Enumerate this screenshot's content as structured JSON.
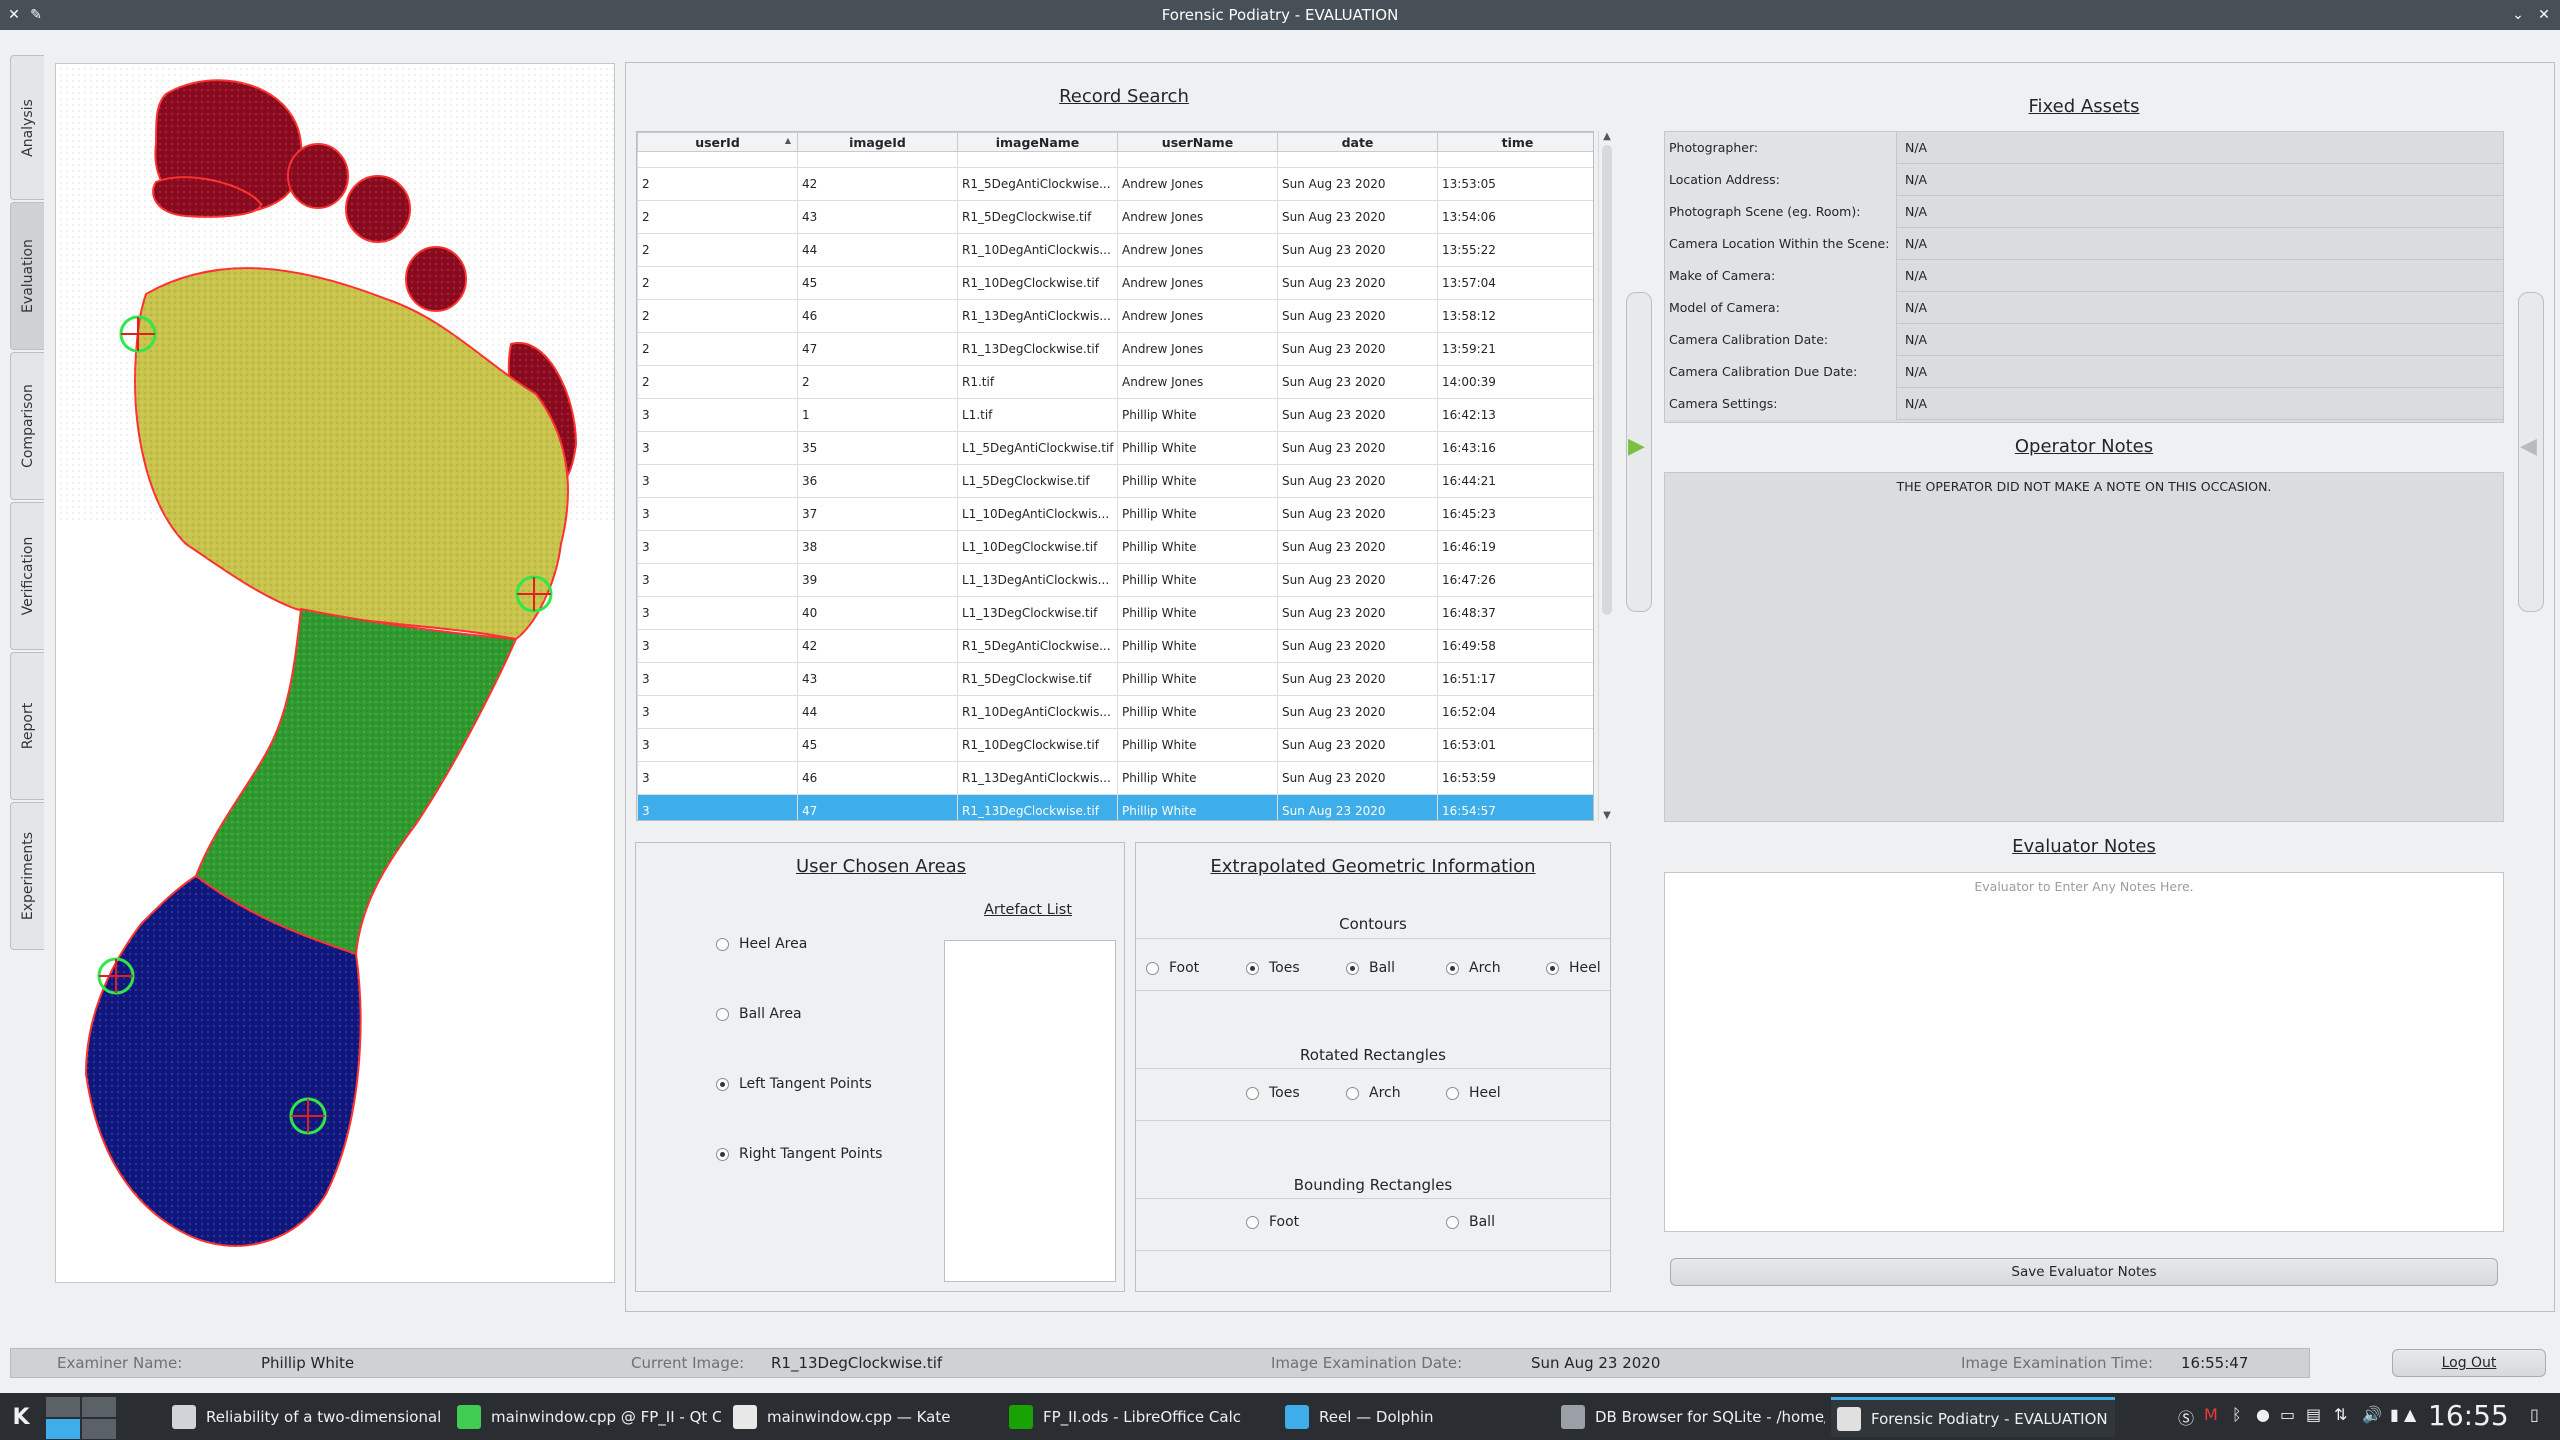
{
  "window": {
    "title": "Forensic Podiatry - EVALUATION"
  },
  "side_tabs": [
    "Analysis",
    "Evaluation",
    "Comparison",
    "Verification",
    "Report",
    "Experiments"
  ],
  "record_search": {
    "title": "Record Search",
    "columns": [
      "userId",
      "imageId",
      "imageName",
      "userName",
      "date",
      "time"
    ],
    "rows": [
      [
        "2",
        "42",
        "R1_5DegAntiClockwise...",
        "Andrew Jones",
        "Sun Aug 23 2020",
        "13:53:05"
      ],
      [
        "2",
        "43",
        "R1_5DegClockwise.tif",
        "Andrew Jones",
        "Sun Aug 23 2020",
        "13:54:06"
      ],
      [
        "2",
        "44",
        "R1_10DegAntiClockwis...",
        "Andrew Jones",
        "Sun Aug 23 2020",
        "13:55:22"
      ],
      [
        "2",
        "45",
        "R1_10DegClockwise.tif",
        "Andrew Jones",
        "Sun Aug 23 2020",
        "13:57:04"
      ],
      [
        "2",
        "46",
        "R1_13DegAntiClockwis...",
        "Andrew Jones",
        "Sun Aug 23 2020",
        "13:58:12"
      ],
      [
        "2",
        "47",
        "R1_13DegClockwise.tif",
        "Andrew Jones",
        "Sun Aug 23 2020",
        "13:59:21"
      ],
      [
        "2",
        "2",
        "R1.tif",
        "Andrew Jones",
        "Sun Aug 23 2020",
        "14:00:39"
      ],
      [
        "3",
        "1",
        "L1.tif",
        "Phillip White",
        "Sun Aug 23 2020",
        "16:42:13"
      ],
      [
        "3",
        "35",
        "L1_5DegAntiClockwise.tif",
        "Phillip White",
        "Sun Aug 23 2020",
        "16:43:16"
      ],
      [
        "3",
        "36",
        "L1_5DegClockwise.tif",
        "Phillip White",
        "Sun Aug 23 2020",
        "16:44:21"
      ],
      [
        "3",
        "37",
        "L1_10DegAntiClockwis...",
        "Phillip White",
        "Sun Aug 23 2020",
        "16:45:23"
      ],
      [
        "3",
        "38",
        "L1_10DegClockwise.tif",
        "Phillip White",
        "Sun Aug 23 2020",
        "16:46:19"
      ],
      [
        "3",
        "39",
        "L1_13DegAntiClockwis...",
        "Phillip White",
        "Sun Aug 23 2020",
        "16:47:26"
      ],
      [
        "3",
        "40",
        "L1_13DegClockwise.tif",
        "Phillip White",
        "Sun Aug 23 2020",
        "16:48:37"
      ],
      [
        "3",
        "42",
        "R1_5DegAntiClockwise...",
        "Phillip White",
        "Sun Aug 23 2020",
        "16:49:58"
      ],
      [
        "3",
        "43",
        "R1_5DegClockwise.tif",
        "Phillip White",
        "Sun Aug 23 2020",
        "16:51:17"
      ],
      [
        "3",
        "44",
        "R1_10DegAntiClockwis...",
        "Phillip White",
        "Sun Aug 23 2020",
        "16:52:04"
      ],
      [
        "3",
        "45",
        "R1_10DegClockwise.tif",
        "Phillip White",
        "Sun Aug 23 2020",
        "16:53:01"
      ],
      [
        "3",
        "46",
        "R1_13DegAntiClockwis...",
        "Phillip White",
        "Sun Aug 23 2020",
        "16:53:59"
      ],
      [
        "3",
        "47",
        "R1_13DegClockwise.tif",
        "Phillip White",
        "Sun Aug 23 2020",
        "16:54:57"
      ]
    ],
    "selected_row": 19
  },
  "user_areas": {
    "title": "User Chosen Areas",
    "artefact_title": "Artefact List",
    "options": [
      {
        "label": "Heel Area",
        "checked": false
      },
      {
        "label": "Ball Area",
        "checked": false
      },
      {
        "label": "Left Tangent Points",
        "checked": true
      },
      {
        "label": "Right Tangent Points",
        "checked": true
      }
    ]
  },
  "geometric": {
    "title": "Extrapolated Geometric Information",
    "contours_title": "Contours",
    "contours": [
      {
        "label": "Foot",
        "checked": false
      },
      {
        "label": "Toes",
        "checked": true
      },
      {
        "label": "Ball",
        "checked": true
      },
      {
        "label": "Arch",
        "checked": true
      },
      {
        "label": "Heel",
        "checked": true
      }
    ],
    "rotated_title": "Rotated Rectangles",
    "rotated": [
      {
        "label": "Toes",
        "checked": false
      },
      {
        "label": "Arch",
        "checked": false
      },
      {
        "label": "Heel",
        "checked": false
      }
    ],
    "bounding_title": "Bounding Rectangles",
    "bounding": [
      {
        "label": "Foot",
        "checked": false
      },
      {
        "label": "Ball",
        "checked": false
      }
    ]
  },
  "fixed_assets": {
    "title": "Fixed Assets",
    "rows": [
      {
        "key": "Photographer:",
        "value": "N/A"
      },
      {
        "key": "Location Address:",
        "value": "N/A"
      },
      {
        "key": "Photograph Scene (eg. Room):",
        "value": "N/A"
      },
      {
        "key": "Camera Location Within the Scene:",
        "value": "N/A"
      },
      {
        "key": "Make of Camera:",
        "value": "N/A"
      },
      {
        "key": "Model of Camera:",
        "value": "N/A"
      },
      {
        "key": "Camera Calibration Date:",
        "value": "N/A"
      },
      {
        "key": "Camera Calibration Due Date:",
        "value": "N/A"
      },
      {
        "key": "Camera Settings:",
        "value": "N/A"
      }
    ]
  },
  "operator_notes": {
    "title": "Operator Notes",
    "text": "THE OPERATOR DID NOT MAKE A NOTE ON THIS OCCASION."
  },
  "evaluator_notes": {
    "title": "Evaluator Notes",
    "placeholder": "Evaluator to Enter Any Notes Here.",
    "save_label": "Save Evaluator Notes"
  },
  "status": {
    "examiner_label": "Examiner Name:",
    "examiner": "Phillip White",
    "image_label": "Current Image:",
    "image": "R1_13DegClockwise.tif",
    "date_label": "Image Examination Date:",
    "date": "Sun Aug 23 2020",
    "time_label": "Image Examination Time:",
    "time": "16:55:47",
    "logout_label": "Log Out"
  },
  "taskbar": {
    "tasks": [
      {
        "label": "Reliability of a two-dimensional ...",
        "icon_color": "#d0d4d8"
      },
      {
        "label": "mainwindow.cpp @ FP_II - Qt Cr...",
        "icon_color": "#41cd52"
      },
      {
        "label": "mainwindow.cpp — Kate",
        "icon_color": "#e8e8e8"
      },
      {
        "label": "FP_II.ods - LibreOffice Calc",
        "icon_color": "#18a303"
      },
      {
        "label": "Reel — Dolphin",
        "icon_color": "#3daee9"
      },
      {
        "label": "DB Browser for SQLite - /home/...",
        "icon_color": "#9aa0a6"
      },
      {
        "label": "Forensic Podiatry - EVALUATION",
        "icon_color": "#e0e0e0"
      }
    ],
    "clock": "16:55"
  },
  "colors": {
    "accent": "#3daee9",
    "toes": "#8b0a1e",
    "ball": "#c8c34a",
    "arch": "#2e9a2e",
    "heel": "#101880",
    "marker": "#2ee84a"
  }
}
